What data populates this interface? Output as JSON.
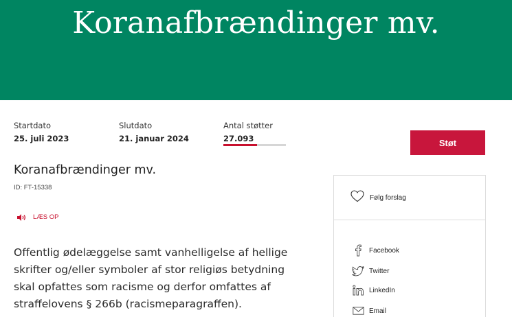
{
  "hero": {
    "title": "Koranafbrændinger mv."
  },
  "stats": {
    "start": {
      "label": "Startdato",
      "value": "25. juli 2023"
    },
    "end": {
      "label": "Slutdato",
      "value": "21. januar 2024"
    },
    "supporters": {
      "label": "Antal støtter",
      "value": "27.093",
      "progress_fraction": 0.54
    }
  },
  "support_button": {
    "label": "Støt"
  },
  "proposal": {
    "title": "Koranafbrændinger mv.",
    "id": "ID: FT-15338",
    "read_aloud": "LÆS OP",
    "body": "Offentlig ødelæggelse samt vanhelligelse af hellige skrifter og/eller symboler af stor religiøs betydning skal opfattes som racisme og derfor omfattes af straffelovens § 266b (racismeparagraffen)."
  },
  "side_panel": {
    "follow_label": "Følg forslag",
    "share": [
      {
        "label": "Facebook",
        "icon": "facebook-icon"
      },
      {
        "label": "Twitter",
        "icon": "twitter-icon"
      },
      {
        "label": "LinkedIn",
        "icon": "linkedin-icon"
      },
      {
        "label": "Email",
        "icon": "email-icon"
      }
    ]
  },
  "colors": {
    "hero_green": "#008561",
    "accent_red": "#c8163c",
    "progress_track": "#d6d6d6"
  }
}
